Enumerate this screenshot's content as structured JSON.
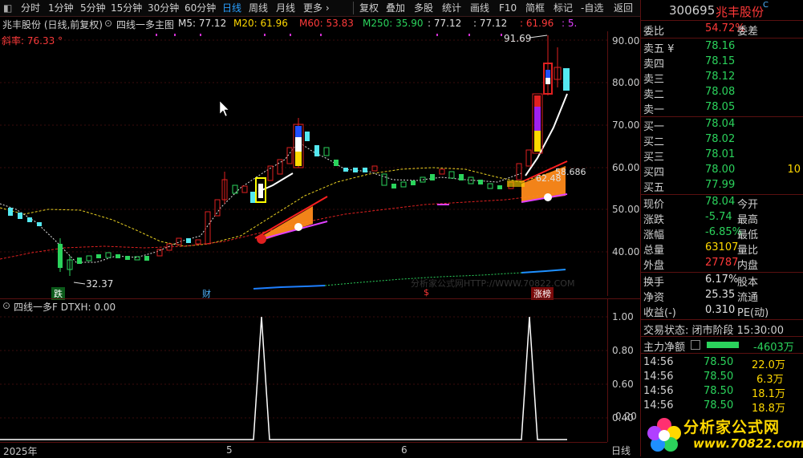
{
  "toolbar": {
    "items": [
      {
        "label": "分时"
      },
      {
        "label": "1分钟"
      },
      {
        "label": "5分钟"
      },
      {
        "label": "15分钟"
      },
      {
        "label": "30分钟"
      },
      {
        "label": "60分钟"
      },
      {
        "label": "日线"
      },
      {
        "label": "周线"
      },
      {
        "label": "月线"
      },
      {
        "label": "更多 ›"
      },
      {
        "label": "复权"
      },
      {
        "label": "叠加"
      },
      {
        "label": "多股"
      },
      {
        "label": "统计"
      },
      {
        "label": "画线"
      },
      {
        "label": "F10"
      },
      {
        "label": "简框"
      },
      {
        "label": "标记"
      },
      {
        "label": "-自选"
      },
      {
        "label": "返回"
      }
    ],
    "left_glyph": "◧"
  },
  "infobar": {
    "title": "兆丰股份 (日线,前复权)",
    "indicator": "四线一多主图",
    "m5": "M5: 77.12",
    "m20": "M20: 61.96",
    "m60": "M60: 53.83",
    "m250": "M250: 35.90",
    "v1": ": 77.12",
    "v2": ": 77.12",
    "v3": ": 61.96",
    "v4": ": 5.",
    "slope": "斜率: 76.33 °"
  },
  "main_axis": {
    "ticks": [
      "90.00",
      "80.00",
      "70.00",
      "60.00",
      "50.00",
      "40.00"
    ]
  },
  "annotations": {
    "high": "91.69",
    "low": "32.37",
    "mid1": "62.48",
    "mid2": "58.686",
    "tag_die": "跌",
    "tag_cai": "财",
    "tag_s": "$",
    "tag_zt": "涨榜",
    "watermark": "分析家公式网HTTP://WWW.70822.COM"
  },
  "sub": {
    "title": "四线一多F  DTXH: 0.00",
    "ticks": [
      "1.00",
      "0.80",
      "0.60",
      "0.40",
      "0.20"
    ]
  },
  "time_axis": {
    "labels": [
      "2025年",
      "5",
      "6"
    ],
    "period": "日线"
  },
  "panel": {
    "code": "300695",
    "name": "兆丰股份",
    "weibi_label": "委比",
    "weibi": "54.72%",
    "weicha_label": "委差",
    "sells": [
      {
        "label": "卖五 ¥",
        "price": "78.16"
      },
      {
        "label": "卖四",
        "price": "78.15"
      },
      {
        "label": "卖三",
        "price": "78.12"
      },
      {
        "label": "卖二",
        "price": "78.08"
      },
      {
        "label": "卖一",
        "price": "78.05"
      }
    ],
    "buys": [
      {
        "label": "买一",
        "price": "78.04",
        "vol": ""
      },
      {
        "label": "买二",
        "price": "78.02",
        "vol": ""
      },
      {
        "label": "买三",
        "price": "78.01",
        "vol": ""
      },
      {
        "label": "买四",
        "price": "78.00",
        "vol": "10"
      },
      {
        "label": "买五",
        "price": "77.99",
        "vol": ""
      }
    ],
    "stats": [
      {
        "l1": "现价",
        "v": "78.04",
        "c": "green",
        "l2": "今开"
      },
      {
        "l1": "涨跌",
        "v": "-5.74",
        "c": "green",
        "l2": "最高"
      },
      {
        "l1": "涨幅",
        "v": "-6.85%",
        "c": "green",
        "l2": "最低"
      },
      {
        "l1": "总量",
        "v": "63107",
        "c": "yellow",
        "l2": "量比"
      },
      {
        "l1": "外盘",
        "v": "27787",
        "c": "red",
        "l2": "内盘"
      }
    ],
    "stats2": [
      {
        "l1": "换手",
        "v": "6.17%",
        "c": "white",
        "l2": "股本"
      },
      {
        "l1": "净资",
        "v": "25.35",
        "c": "white",
        "l2": "流通"
      },
      {
        "l1": "收益(-)",
        "v": "0.310",
        "c": "white",
        "l2": "PE(动)"
      }
    ],
    "trade_state": "交易状态: 闭市阶段 15:30:00",
    "net_label": "主力净额",
    "net_value": "-4603万",
    "ticks": [
      {
        "t": "14:56",
        "p": "78.50",
        "v": "22.0万"
      },
      {
        "t": "14:56",
        "p": "78.50",
        "v": "6.3万"
      },
      {
        "t": "14:56",
        "p": "78.50",
        "v": "18.1万"
      },
      {
        "t": "14:56",
        "p": "78.50",
        "v": "18.8万"
      }
    ],
    "logo_text": "分析家公式网",
    "logo_url": "www.70822.com"
  }
}
